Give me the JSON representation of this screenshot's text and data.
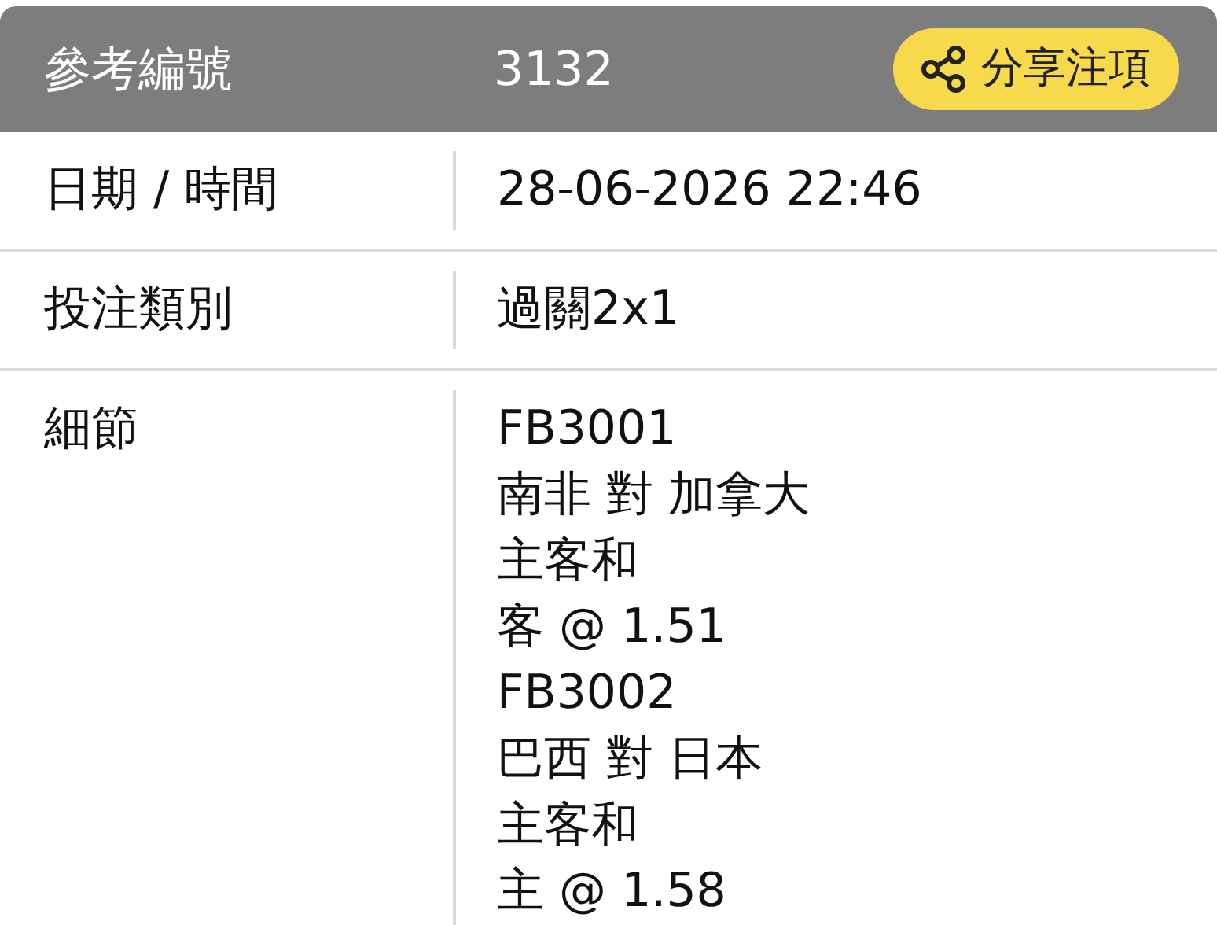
{
  "header": {
    "label": "參考編號",
    "value": "3132",
    "share_button": "分享注項"
  },
  "rows": [
    {
      "label": "日期 / 時間",
      "lines": [
        "28-06-2026 22:46"
      ]
    },
    {
      "label": "投注類別",
      "lines": [
        "過關2x1"
      ]
    },
    {
      "label": "細節",
      "lines": [
        "FB3001",
        "南非 對 加拿大",
        "主客和",
        "客 @ 1.51",
        "FB3002",
        "巴西 對 日本",
        "主客和",
        "主 @ 1.58"
      ]
    }
  ]
}
